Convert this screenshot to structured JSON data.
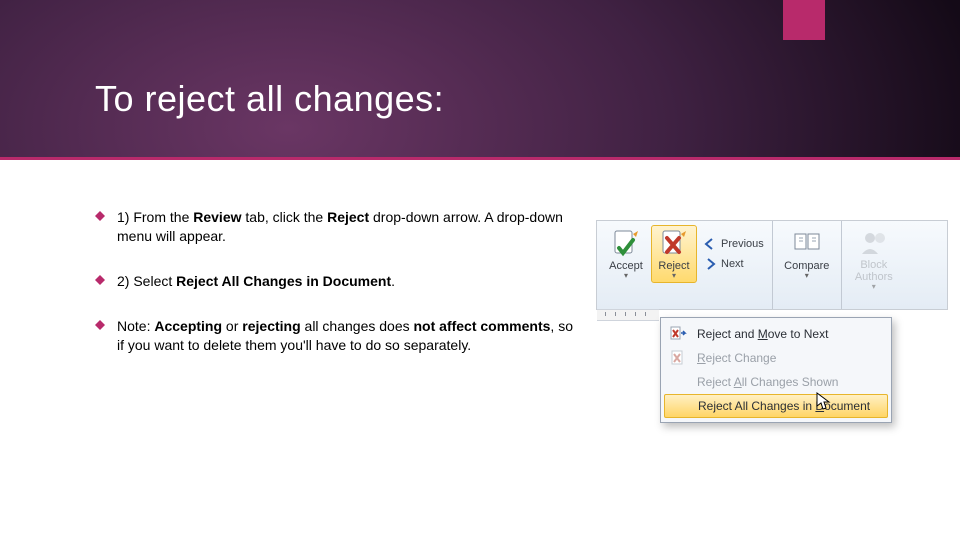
{
  "header": {
    "title": "To reject all changes:"
  },
  "bullets": {
    "b1_pre": "1) From the ",
    "b1_bold1": "Review",
    "b1_mid": " tab, click the ",
    "b1_bold2": "Reject",
    "b1_post": " drop-down arrow. A drop-down menu will appear.",
    "b2_pre": "2) Select ",
    "b2_bold": "Reject All Changes in Document",
    "b2_post": ".",
    "b3_pre": "Note: ",
    "b3_bold1": "Accepting",
    "b3_mid1": " or ",
    "b3_bold2": "rejecting",
    "b3_mid2": " all changes does ",
    "b3_bold3": "not affect comments",
    "b3_post": ", so if you want to delete them you'll have to do so separately."
  },
  "ribbon": {
    "accept": "Accept",
    "reject": "Reject",
    "previous": "Previous",
    "next": "Next",
    "compare": "Compare",
    "block": "Block Authors"
  },
  "menu": {
    "m1_pre": "Reject and ",
    "m1_ul": "M",
    "m1_post": "ove to Next",
    "m2_ul": "R",
    "m2_post": "eject Change",
    "m3_pre": "Reject ",
    "m3_ul": "A",
    "m3_post": "ll Changes Shown",
    "m4_pre": "Reject All Changes in ",
    "m4_ul": "D",
    "m4_post": "ocument"
  }
}
